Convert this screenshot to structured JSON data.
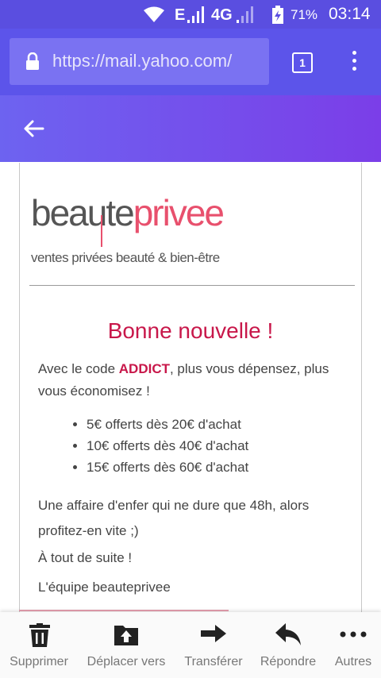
{
  "status_bar": {
    "network_e": "E",
    "network_4g": "4G",
    "battery_percent": "71%",
    "time": "03:14",
    "icons": [
      "wifi-icon",
      "signal-icon",
      "battery-icon"
    ]
  },
  "browser": {
    "url": "https://mail.yahoo.com/",
    "tab_count": "1",
    "icons": [
      "lock-icon",
      "tabs-icon",
      "overflow-menu-icon"
    ]
  },
  "app_header": {
    "icons": [
      "back-arrow-icon"
    ]
  },
  "email": {
    "logo_main": "beaute",
    "logo_accent": "privee",
    "logo_tagline": "ventes privées beauté & bien-être",
    "headline": "Bonne nouvelle !",
    "intro_before_code": "Avec le code ",
    "promo_code": "ADDICT",
    "intro_after_code": ", plus vous dépensez, plus vous économisez !",
    "offers": [
      "5€ offerts dès 20€ d'achat",
      "10€ offerts dès 40€ d'achat",
      "15€ offerts dès 60€ d'achat"
    ],
    "deal_text": "Une affaire d'enfer qui ne dure que 48h, alors profitez-en vite ;)",
    "greeting": "À tout de suite !",
    "signature": "L'équipe beauteprivee",
    "colors": {
      "accent": "#c8174a",
      "logo_pink": "#e8506d"
    }
  },
  "toolbar": {
    "items": [
      {
        "label": "Supprimer",
        "icon": "trash-icon"
      },
      {
        "label": "Déplacer vers",
        "icon": "move-to-folder-icon"
      },
      {
        "label": "Transférer",
        "icon": "forward-arrow-icon"
      },
      {
        "label": "Répondre",
        "icon": "reply-icon"
      },
      {
        "label": "Autres",
        "icon": "more-dots-icon"
      }
    ]
  },
  "theme": {
    "browser_bar": "#5c54ea",
    "header_start": "#6d63f0",
    "header_end": "#7b3ee8"
  }
}
